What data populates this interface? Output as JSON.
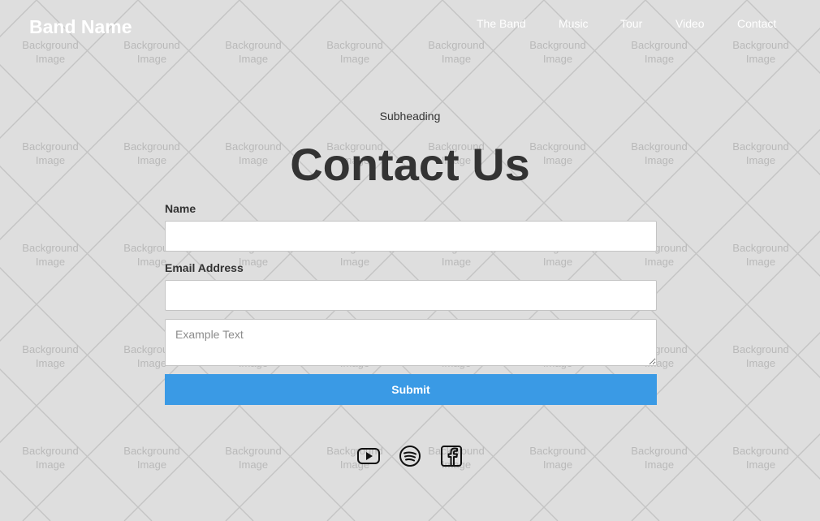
{
  "brand": {
    "name": "Band Name"
  },
  "nav": {
    "items": [
      {
        "label": "The Band"
      },
      {
        "label": "Music"
      },
      {
        "label": "Tour"
      },
      {
        "label": "Video"
      },
      {
        "label": "Contact"
      }
    ]
  },
  "background": {
    "placeholder_line1": "Background",
    "placeholder_line2": "Image"
  },
  "hero": {
    "subheading": "Subheading",
    "title": "Contact Us"
  },
  "form": {
    "name_label": "Name",
    "name_value": "",
    "email_label": "Email Address",
    "email_value": "",
    "message_placeholder": "Example Text",
    "submit_label": "Submit",
    "accent_color": "#3a9ae5"
  },
  "social": {
    "icons": [
      "youtube-icon",
      "spotify-icon",
      "facebook-icon"
    ]
  }
}
